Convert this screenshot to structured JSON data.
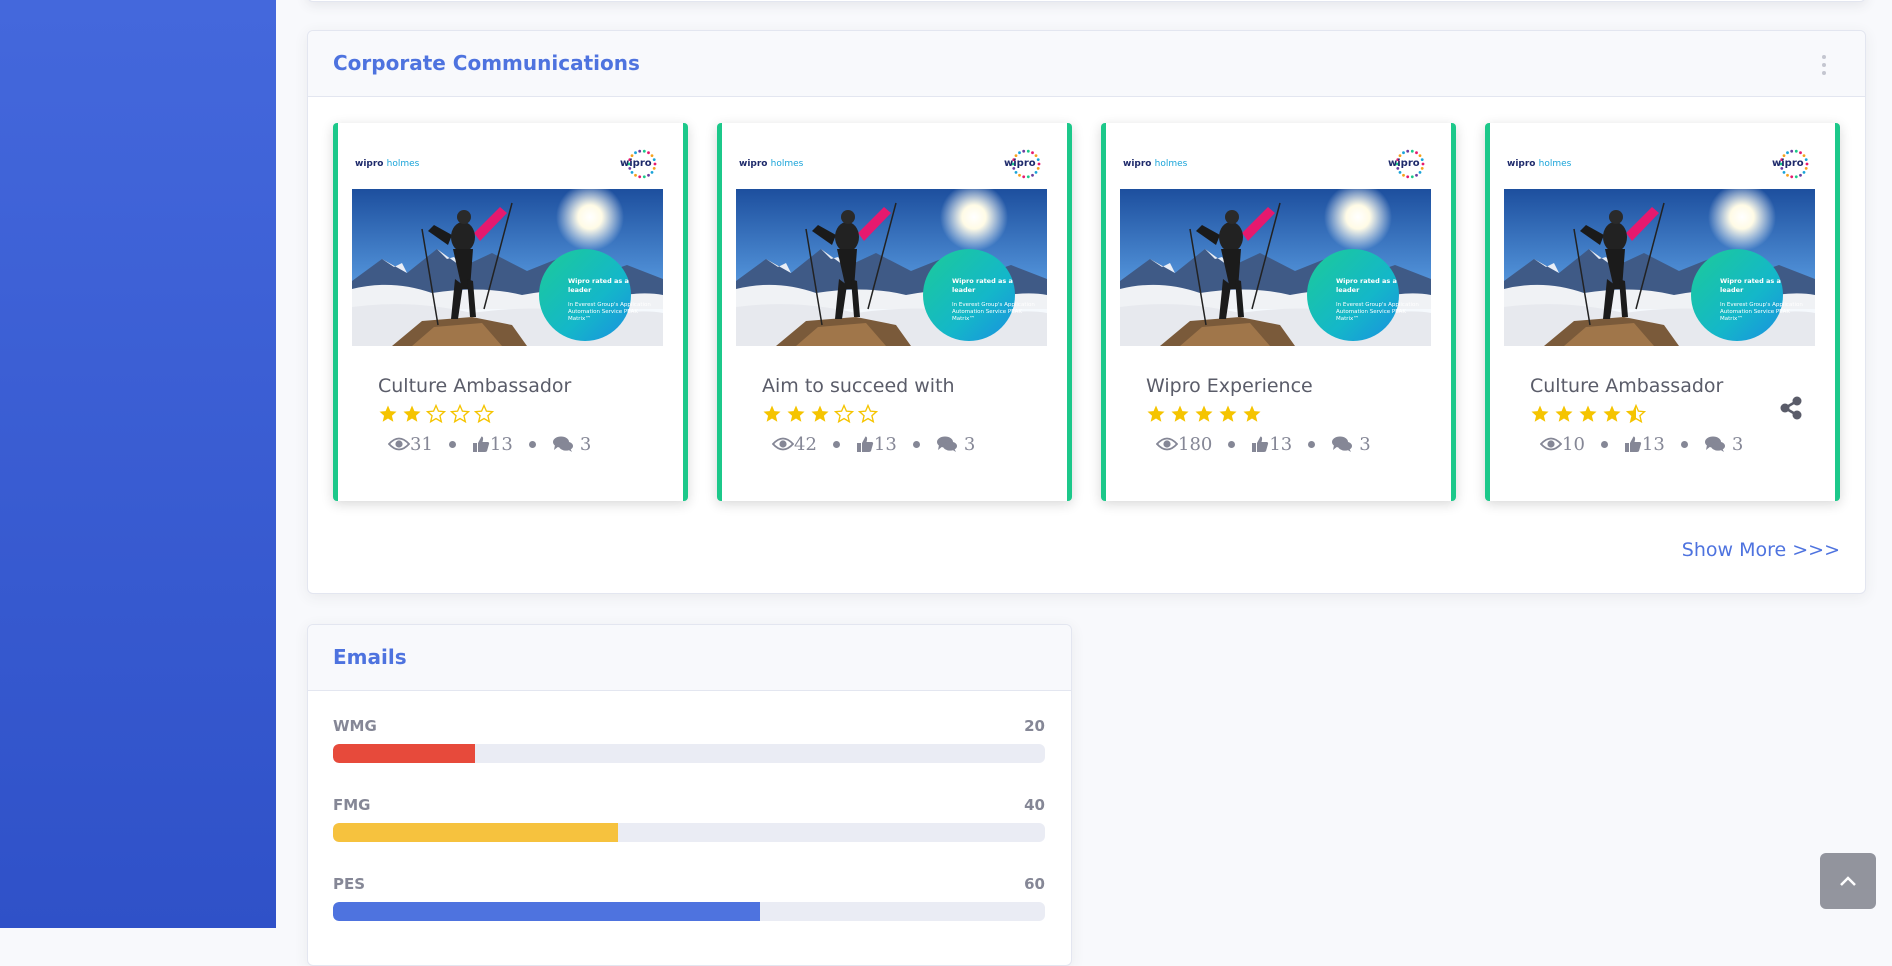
{
  "corporate": {
    "title": "Corporate Communications",
    "show_more": "Show More >>>",
    "cards": [
      {
        "brand_main": "wipro",
        "brand_sub": "holmes",
        "logo_text": "wipro",
        "badge_title": "Wipro rated as a leader",
        "badge_body": "In Everest Group's Application Automation Service PEAK Matrix™",
        "title": "Culture Ambassador",
        "rating": 2,
        "views": "31",
        "likes": "13",
        "comments": "3"
      },
      {
        "brand_main": "wipro",
        "brand_sub": "holmes",
        "logo_text": "wipro",
        "badge_title": "Wipro rated as a leader",
        "badge_body": "In Everest Group's Application Automation Service PEAK Matrix™",
        "title": "Aim to succeed with",
        "rating": 3,
        "views": "42",
        "likes": "13",
        "comments": "3"
      },
      {
        "brand_main": "wipro",
        "brand_sub": "holmes",
        "logo_text": "wipro",
        "badge_title": "Wipro rated as a leader",
        "badge_body": "In Everest Group's Application Automation Service PEAK Matrix™",
        "title": "Wipro Experience",
        "rating": 5,
        "views": "180",
        "likes": "13",
        "comments": "3"
      },
      {
        "brand_main": "wipro",
        "brand_sub": "holmes",
        "logo_text": "wipro",
        "badge_title": "Wipro rated as a leader",
        "badge_body": "In Everest Group's Application Automation Service PEAK Matrix™",
        "title": "Culture Ambassador",
        "rating": 4.5,
        "views": "10",
        "likes": "13",
        "comments": "3",
        "share": true
      }
    ]
  },
  "emails": {
    "title": "Emails",
    "rows": [
      {
        "label": "WMG",
        "value": "20",
        "percent": 20,
        "color": "#e74a3b"
      },
      {
        "label": "FMG",
        "value": "40",
        "percent": 40,
        "color": "#f6c23e"
      },
      {
        "label": "PES",
        "value": "60",
        "percent": 60,
        "color": "#4e73df"
      }
    ]
  },
  "colors": {
    "primary": "#4e73df",
    "success": "#1cc88a",
    "star": "#f5c400",
    "muted": "#858796"
  },
  "icons": {
    "views": "eye-icon",
    "likes": "thumbs-up-icon",
    "comments": "comments-icon",
    "share": "share-icon",
    "menu": "kebab-menu-icon",
    "back_to_top": "chevron-up-icon"
  }
}
